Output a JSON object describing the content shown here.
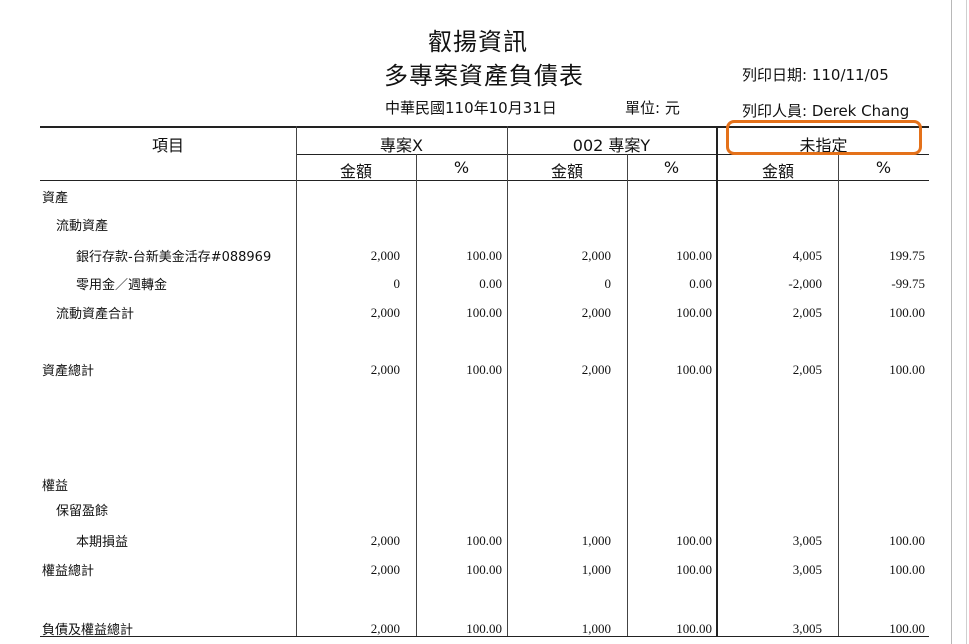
{
  "company": "叡揚資訊",
  "report_title": "多專案資產負債表",
  "report_date": "中華民國110年10月31日",
  "unit": "單位: 元",
  "print_date": "列印日期: 110/11/05",
  "printed_by": "列印人員: Derek Chang",
  "columns": {
    "item": "項目",
    "projects": [
      "專案X",
      "002 專案Y",
      "未指定"
    ],
    "amount": "金額",
    "percent": "%"
  },
  "rows": [
    {
      "label": "資產",
      "values": [
        "",
        "",
        "",
        "",
        "",
        ""
      ]
    },
    {
      "label": "流動資產",
      "values": [
        "",
        "",
        "",
        "",
        "",
        ""
      ]
    },
    {
      "label": "銀行存款-台新美金活存#088969",
      "values": [
        "2,000",
        "100.00",
        "2,000",
        "100.00",
        "4,005",
        "199.75"
      ]
    },
    {
      "label": "零用金／週轉金",
      "values": [
        "0",
        "0.00",
        "0",
        "0.00",
        "-2,000",
        "-99.75"
      ]
    },
    {
      "label": "流動資產合計",
      "values": [
        "2,000",
        "100.00",
        "2,000",
        "100.00",
        "2,005",
        "100.00"
      ]
    },
    {
      "label": "資產總計",
      "values": [
        "2,000",
        "100.00",
        "2,000",
        "100.00",
        "2,005",
        "100.00"
      ]
    },
    {
      "label": "權益",
      "values": [
        "",
        "",
        "",
        "",
        "",
        ""
      ]
    },
    {
      "label": "保留盈餘",
      "values": [
        "",
        "",
        "",
        "",
        "",
        ""
      ]
    },
    {
      "label": "本期損益",
      "values": [
        "2,000",
        "100.00",
        "1,000",
        "100.00",
        "3,005",
        "100.00"
      ]
    },
    {
      "label": "權益總計",
      "values": [
        "2,000",
        "100.00",
        "1,000",
        "100.00",
        "3,005",
        "100.00"
      ]
    },
    {
      "label": "負債及權益總計",
      "values": [
        "2,000",
        "100.00",
        "1,000",
        "100.00",
        "3,005",
        "100.00"
      ]
    }
  ]
}
